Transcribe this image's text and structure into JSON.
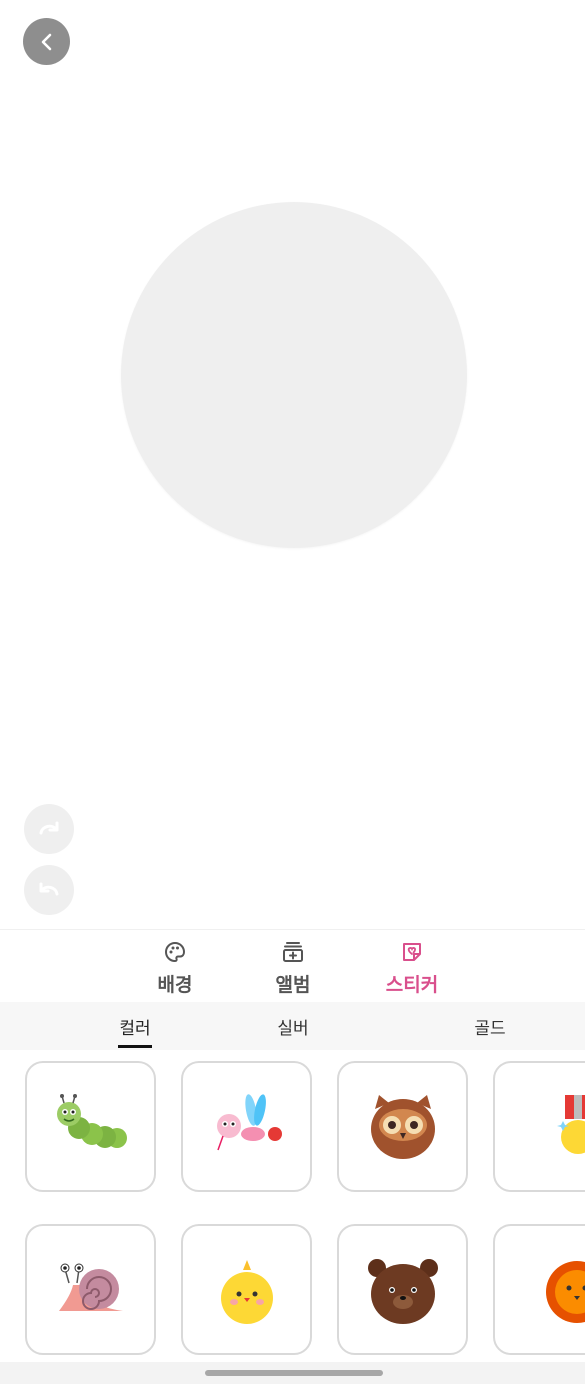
{
  "toolbar": {
    "back_icon": "chevron-left-icon"
  },
  "history": {
    "redo_icon": "redo-icon",
    "undo_icon": "undo-icon"
  },
  "mode_tabs": [
    {
      "label": "배경",
      "icon": "palette-icon",
      "active": false
    },
    {
      "label": "앨범",
      "icon": "album-add-icon",
      "active": false
    },
    {
      "label": "스티커",
      "icon": "sticker-icon",
      "active": true
    }
  ],
  "sub_tabs": [
    {
      "label": "컬러",
      "active": true
    },
    {
      "label": "실버",
      "active": false
    },
    {
      "label": "골드",
      "active": false
    }
  ],
  "stickers": [
    {
      "name": "caterpillar-sticker"
    },
    {
      "name": "dragonfly-sticker"
    },
    {
      "name": "owl-sticker"
    },
    {
      "name": "medal-sticker"
    },
    {
      "name": "snail-sticker"
    },
    {
      "name": "chick-sticker"
    },
    {
      "name": "bear-sticker"
    },
    {
      "name": "lion-sticker"
    }
  ],
  "colors": {
    "accent": "#d94f8c",
    "back_button": "#8e8e8e",
    "canvas": "#efefef"
  }
}
